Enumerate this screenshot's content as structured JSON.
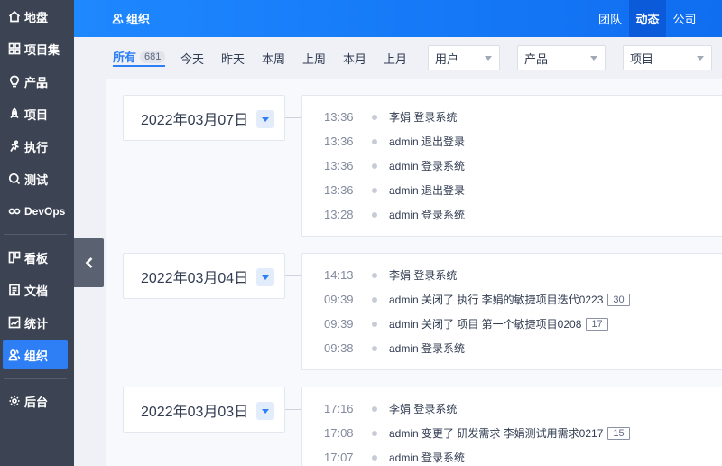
{
  "sidebar": {
    "items": [
      {
        "label": "地盘",
        "icon": "home-icon"
      },
      {
        "label": "项目集",
        "icon": "grid-icon"
      },
      {
        "label": "产品",
        "icon": "lightbulb-icon"
      },
      {
        "label": "项目",
        "icon": "rocket-icon"
      },
      {
        "label": "执行",
        "icon": "run-icon"
      },
      {
        "label": "测试",
        "icon": "bug-search-icon"
      },
      {
        "label": "DevOps",
        "icon": "infinity-icon"
      },
      {
        "label": "看板",
        "icon": "kanban-icon"
      },
      {
        "label": "文档",
        "icon": "doc-icon"
      },
      {
        "label": "统计",
        "icon": "chart-icon"
      },
      {
        "label": "组织",
        "icon": "users-icon",
        "active": true
      },
      {
        "label": "后台",
        "icon": "gear-icon"
      }
    ]
  },
  "header": {
    "title": "组织",
    "tabs": [
      {
        "label": "团队"
      },
      {
        "label": "动态",
        "active": true
      },
      {
        "label": "公司"
      }
    ]
  },
  "filters": {
    "tabs": [
      {
        "label": "所有",
        "count": "681",
        "active": true
      },
      {
        "label": "今天"
      },
      {
        "label": "昨天"
      },
      {
        "label": "本周"
      },
      {
        "label": "上周"
      },
      {
        "label": "本月"
      },
      {
        "label": "上月"
      }
    ],
    "selects": [
      {
        "value": "用户"
      },
      {
        "value": "产品"
      },
      {
        "value": "项目"
      }
    ]
  },
  "groups": [
    {
      "date": "2022年03月07日",
      "entries": [
        {
          "time": "13:36",
          "text": "李娟 登录系统"
        },
        {
          "time": "13:36",
          "text": "admin 退出登录"
        },
        {
          "time": "13:36",
          "text": "admin 登录系统"
        },
        {
          "time": "13:36",
          "text": "admin 退出登录"
        },
        {
          "time": "13:28",
          "text": "admin 登录系统"
        }
      ]
    },
    {
      "date": "2022年03月04日",
      "entries": [
        {
          "time": "14:13",
          "text": "李娟 登录系统"
        },
        {
          "time": "09:39",
          "text": "admin 关闭了 执行 李娟的敏捷项目迭代0223",
          "badge": "30"
        },
        {
          "time": "09:39",
          "text": "admin 关闭了 项目 第一个敏捷项目0208",
          "badge": "17"
        },
        {
          "time": "09:38",
          "text": "admin 登录系统"
        }
      ]
    },
    {
      "date": "2022年03月03日",
      "entries": [
        {
          "time": "17:16",
          "text": "李娟 登录系统"
        },
        {
          "time": "17:08",
          "text": "admin 变更了 研发需求 李娟测试用需求0217",
          "badge": "15"
        },
        {
          "time": "17:07",
          "text": "admin 登录系统"
        }
      ]
    }
  ],
  "colors": {
    "sidebar_bg": "#3c4353",
    "accent": "#2e7ff5",
    "header_bg": "#1e88ff"
  }
}
